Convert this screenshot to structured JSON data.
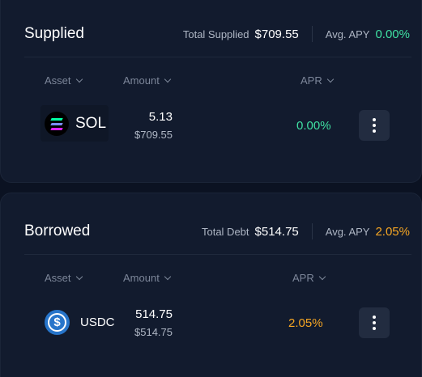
{
  "supplied": {
    "title": "Supplied",
    "total_label": "Total Supplied",
    "total_value": "$709.55",
    "apy_label": "Avg. APY",
    "apy_value": "0.00%",
    "columns": {
      "asset": "Asset",
      "amount": "Amount",
      "apr": "APR"
    },
    "rows": [
      {
        "asset": "SOL",
        "icon": "sol-icon",
        "amount": "5.13",
        "amount_usd": "$709.55",
        "apr": "0.00%"
      }
    ]
  },
  "borrowed": {
    "title": "Borrowed",
    "total_label": "Total Debt",
    "total_value": "$514.75",
    "apy_label": "Avg. APY",
    "apy_value": "2.05%",
    "columns": {
      "asset": "Asset",
      "amount": "Amount",
      "apr": "APR"
    },
    "rows": [
      {
        "asset": "USDC",
        "icon": "usdc-icon",
        "amount": "514.75",
        "amount_usd": "$514.75",
        "apr": "2.05%"
      }
    ]
  },
  "colors": {
    "background": "#0b1222",
    "panel": "#121b2e",
    "green": "#3fe0a2",
    "orange": "#f6a623",
    "usdc_blue": "#2775ca"
  }
}
